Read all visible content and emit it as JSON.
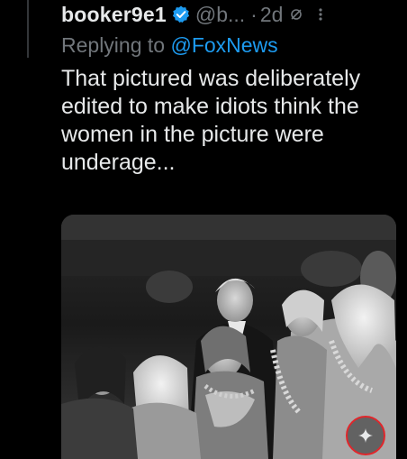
{
  "tweet": {
    "display_name": "booker9e1",
    "handle": "@b...",
    "separator": "·",
    "time": "2d",
    "reply_prefix": "Replying to ",
    "reply_mention": "@FoxNews",
    "text": "That pictured was deliberately edited to make idiots think the women in the picture were underage..."
  },
  "icons": {
    "verified": "verified-badge-icon",
    "edited": "edited-icon",
    "more": "more-options-icon",
    "grok": "grok-sparkle-icon"
  },
  "colors": {
    "background": "#000000",
    "text": "#e7e9ea",
    "muted": "#71767b",
    "accent": "#1d9bf0",
    "annotation_circle": "#e0262b"
  }
}
